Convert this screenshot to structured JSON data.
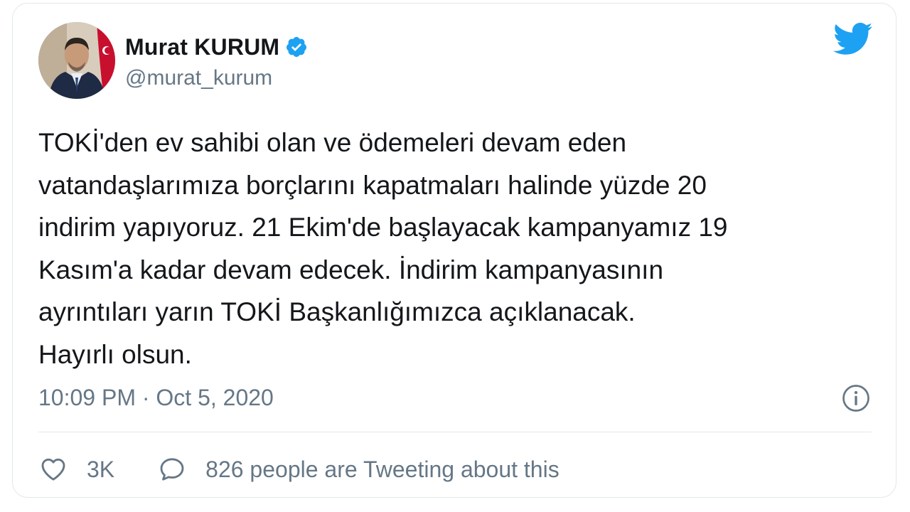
{
  "author": {
    "display_name": "Murat KURUM",
    "handle": "@murat_kurum",
    "verified": true
  },
  "tweet": {
    "lines": [
      "TOKİ'den ev sahibi olan ve ödemeleri devam eden",
      "vatandaşlarımıza borçlarını kapatmaları halinde yüzde 20",
      "indirim yapıyoruz. 21 Ekim'de başlayacak kampanyamız 19",
      "Kasım'a kadar devam edecek. İndirim kampanyasının",
      "ayrıntıları yarın TOKİ Başkanlığımızca açıklanacak.",
      "Hayırlı olsun."
    ],
    "timestamp": "10:09 PM · Oct 5, 2020"
  },
  "actions": {
    "like_count": "3K",
    "people_text": "826 people are Tweeting about this"
  },
  "icons": {
    "brand": "twitter-bird-icon",
    "verified": "verified-badge-icon",
    "info": "info-icon",
    "like": "heart-icon",
    "reply": "speech-bubble-icon"
  },
  "colors": {
    "brand_blue": "#1da1f2",
    "text_primary": "#14171a",
    "text_secondary": "#657786",
    "border": "#e1e8ed"
  }
}
